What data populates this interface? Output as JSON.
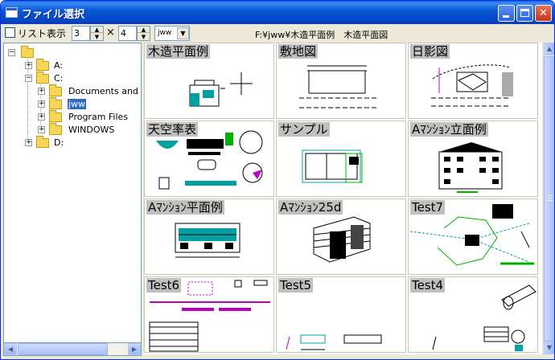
{
  "window": {
    "title": "ファイル選択",
    "buttons": {
      "minimize": "minimize-icon",
      "maximize": "maximize-icon",
      "close": "✕"
    }
  },
  "toolbar": {
    "list_view_label": "リスト表示",
    "list_view_checked": false,
    "columns_value": "3",
    "rows_value": "4",
    "times_sign": "×",
    "drive_value": "jww",
    "current_path": "F:¥jww¥木造平面例　木造平面図"
  },
  "tree": {
    "root_label": "",
    "items": [
      {
        "label": "A:",
        "expander": "+"
      },
      {
        "label": "C:",
        "expander": "−"
      },
      {
        "label": "Documents and S",
        "expander": "+"
      },
      {
        "label": "jww",
        "expander": "+",
        "selected": true
      },
      {
        "label": "Program Files",
        "expander": "+"
      },
      {
        "label": "WINDOWS",
        "expander": "+"
      },
      {
        "label": "D:",
        "expander": "+"
      }
    ]
  },
  "files": [
    {
      "title": "木造平面例"
    },
    {
      "title": "敷地図"
    },
    {
      "title": "日影図"
    },
    {
      "title": "天空率表"
    },
    {
      "title": "サンプル"
    },
    {
      "title": "Aﾏﾝｼｮﾝ立面例"
    },
    {
      "title": "Aﾏﾝｼｮﾝ平面例"
    },
    {
      "title": "Aﾏﾝｼｮﾝ25d"
    },
    {
      "title": "Test7"
    },
    {
      "title": "Test6"
    },
    {
      "title": "Test5"
    },
    {
      "title": "Test4"
    }
  ],
  "colors": {
    "title_bar": "#0b5ad8",
    "window_bg": "#ece9d8",
    "cell_label_bg": "#c0c0c0",
    "drawing_cyan": "#00a0a0",
    "drawing_green": "#00b000",
    "drawing_magenta": "#c000c0"
  }
}
